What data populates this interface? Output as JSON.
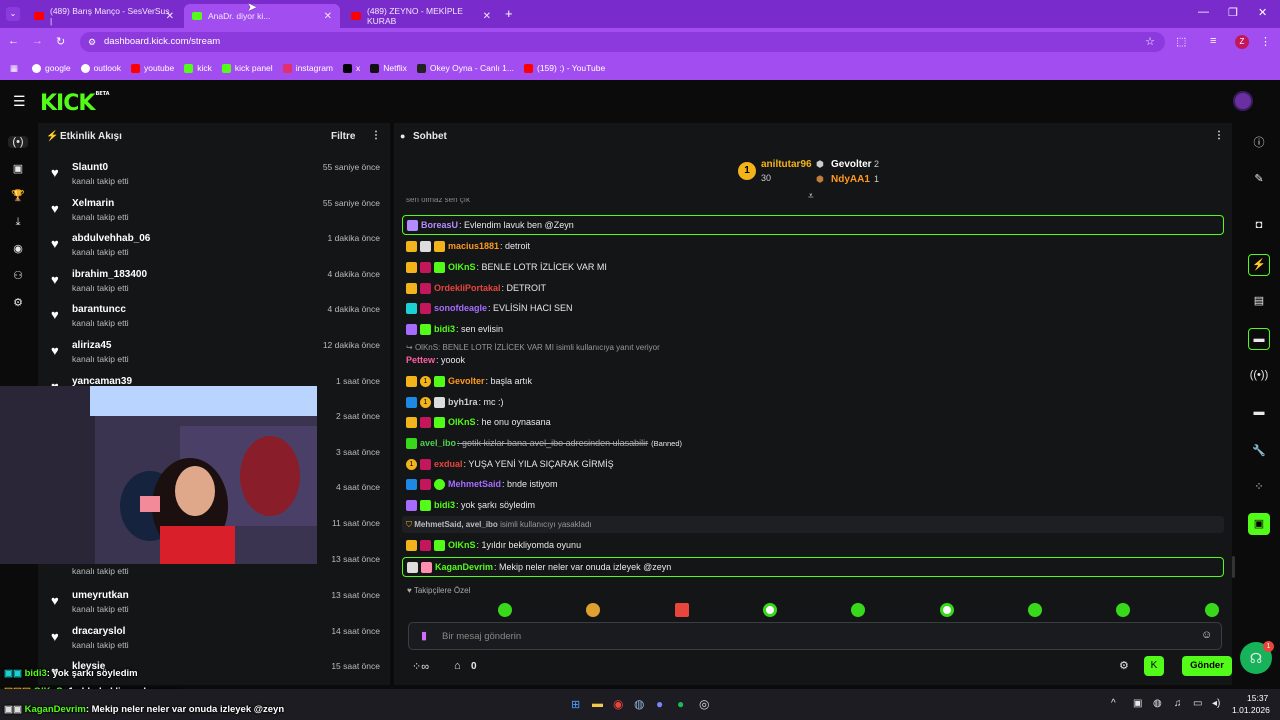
{
  "browser": {
    "tabs": [
      {
        "title": "(489) Barış Manço - SesVerSus |",
        "icon": "youtube-icon"
      },
      {
        "title": "AnaDr. diyor ki...",
        "icon": "kick-icon"
      },
      {
        "title": "(489) ZEYNO - MEKİPLE KURAB",
        "icon": "youtube-icon"
      }
    ],
    "url": "dashboard.kick.com/stream",
    "profile_initial": "Z",
    "bookmarks": [
      {
        "label": "google",
        "icon": "google-icon"
      },
      {
        "label": "outlook",
        "icon": "outlook-icon"
      },
      {
        "label": "youtube",
        "icon": "youtube-icon"
      },
      {
        "label": "kick",
        "icon": "kick-icon"
      },
      {
        "label": "kick panel",
        "icon": "kick-icon"
      },
      {
        "label": "instagram",
        "icon": "instagram-icon"
      },
      {
        "label": "x",
        "icon": "x-icon"
      },
      {
        "label": "Netflix",
        "icon": "netflix-icon"
      },
      {
        "label": "Okey Oyna - Canlı 1...",
        "icon": "okey-icon"
      },
      {
        "label": "(159) :) - YouTube",
        "icon": "youtube-icon"
      }
    ]
  },
  "kick": {
    "logo": "KICK",
    "logo_badge": "BETA"
  },
  "activity": {
    "title": "Etkinlik Akışı",
    "filter_label": "Filtre",
    "items": [
      {
        "name": "Slaunt0",
        "action": "kanalı takip etti",
        "time": "55 saniye önce"
      },
      {
        "name": "Xelmarin",
        "action": "kanalı takip etti",
        "time": "55 saniye önce"
      },
      {
        "name": "abdulvehhab_06",
        "action": "kanalı takip etti",
        "time": "1 dakika önce"
      },
      {
        "name": "ibrahim_183400",
        "action": "kanalı takip etti",
        "time": "4 dakika önce"
      },
      {
        "name": "barantuncc",
        "action": "kanalı takip etti",
        "time": "4 dakika önce"
      },
      {
        "name": "aliriza45",
        "action": "kanalı takip etti",
        "time": "12 dakika önce"
      },
      {
        "name": "yancaman39",
        "action": "",
        "time": "1 saat önce"
      },
      {
        "name": "",
        "action": "",
        "time": "2 saat önce"
      },
      {
        "name": "",
        "action": "",
        "time": "3 saat önce"
      },
      {
        "name": "",
        "action": "",
        "time": "4 saat önce"
      },
      {
        "name": "",
        "action": "",
        "time": "11 saat önce"
      },
      {
        "name": "",
        "action": "kanalı takip etti",
        "time": "13 saat önce"
      },
      {
        "name": "umeyrutkan",
        "action": "kanalı takip etti",
        "time": "13 saat önce"
      },
      {
        "name": "dracaryslol",
        "action": "kanalı takip etti",
        "time": "14 saat önce"
      },
      {
        "name": "kleysie",
        "action": "",
        "time": "15 saat önce"
      }
    ]
  },
  "chat": {
    "title": "Sohbet",
    "leaderboard": {
      "first": {
        "rank": "1",
        "name": "aniltutar96",
        "count": "30"
      },
      "second": {
        "name": "Gevolter",
        "count": "2"
      },
      "third": {
        "name": "NdyAA1",
        "count": "1"
      }
    },
    "partial_top": "sen olmaz sen çık",
    "messages": [
      {
        "user": "BoreasU",
        "color": "#b58cff",
        "text": ": Evlendim lavuk ben @Zeyn",
        "highlight": true
      },
      {
        "user": "macius1881",
        "color": "#ff9a1f",
        "text": ": detroit"
      },
      {
        "user": "OlKnS",
        "color": "#53fc18",
        "text": ": BENLE LOTR İZLİCEK VAR MI"
      },
      {
        "user": "OrdekliPortakal",
        "color": "#e8453c",
        "text": ": DETROIT"
      },
      {
        "user": "sonofdeagle",
        "color": "#a66cff",
        "text": ": EVLİSİN HACI SEN"
      },
      {
        "user": "bidi3",
        "color": "#53fc18",
        "text": ": sen evlisin"
      },
      {
        "user": "Pettew",
        "color": "#ff5fa2",
        "text": ": yoook"
      },
      {
        "user": "Gevolter",
        "color": "#ff9a1f",
        "text": ": başla artık"
      },
      {
        "user": "byh1ra",
        "color": "#cfcfcf",
        "text": ": mc :)"
      },
      {
        "user": "OlKnS",
        "color": "#53fc18",
        "text": ": he onu oynasana"
      },
      {
        "user": "avel_ibo",
        "color": "#4fd14f",
        "text": ": gotik kizlar bana avel_ibo adresinden ulasabilir",
        "banned_tag": "(Banned)"
      },
      {
        "user": "exdual",
        "color": "#e8453c",
        "text": ": YUŞA YENİ YILA SIÇARAK GİRMİŞ"
      },
      {
        "user": "MehmetSaid",
        "color": "#a66cff",
        "text": ": bnde istiyom"
      },
      {
        "user": "bidi3",
        "color": "#53fc18",
        "text": ": yok şarkı söyledim"
      },
      {
        "user": "OlKnS",
        "color": "#53fc18",
        "text": ": 1yıldır bekliyomda oyunu"
      },
      {
        "user": "KaganDevrim",
        "color": "#53fc18",
        "text": ": Mekip neler neler var onuda izleyek @zeyn",
        "highlight": true
      }
    ],
    "reply_note": "OlKnS: BENLE LOTR İZLİCEK VAR MI isimli kullanıcıya yanıt veriyor",
    "ban_note_users": "MehmetSaid, avel_ibo",
    "ban_note_text": "isimli kullanıcıyı yasakladı",
    "followers_only": "Takipçilere Özel",
    "input_placeholder": "Bir mesaj gönderin",
    "points": "0",
    "send_label": "Gönder"
  },
  "overlay_chat": [
    {
      "user": "bidi3",
      "text": ": yok şarkı söyledim"
    },
    {
      "user": "OlKnS",
      "text": ": 1yıldır bekliyomda oyunu"
    },
    {
      "user": "KaganDevrim",
      "text": ": Mekip neler neler var onuda izleyek @zeyn"
    }
  ],
  "taskbar": {
    "time": "15:37",
    "date": "1.01.2026"
  },
  "colors": {
    "kick_green": "#53fc18",
    "browser_purple": "#a24df0",
    "panel_bg": "#141517"
  }
}
